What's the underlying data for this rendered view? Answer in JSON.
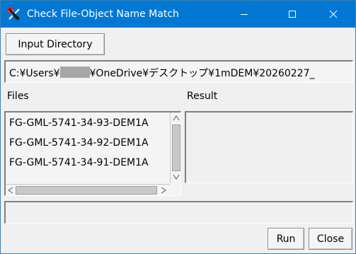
{
  "window": {
    "title": "Check File-Object Name Match",
    "controls": {
      "minimize_icon": "minimize-icon",
      "maximize_icon": "maximize-icon",
      "close_icon": "close-icon"
    }
  },
  "toolbar": {
    "input_directory_label": "Input Directory"
  },
  "path": {
    "prefix": "C:¥Users¥",
    "suffix": "¥OneDrive¥デスクトップ¥1mDEM¥20260227_"
  },
  "files": {
    "label": "Files",
    "items": [
      "FG-GML-5741-34-93-DEM1A",
      "FG-GML-5741-34-92-DEM1A",
      "FG-GML-5741-34-91-DEM1A"
    ]
  },
  "result": {
    "label": "Result"
  },
  "status": {
    "text": ""
  },
  "actions": {
    "run_label": "Run",
    "close_label": "Close"
  },
  "colors": {
    "titlebar": "#0078d4",
    "window_bg": "#f0f0f0"
  }
}
